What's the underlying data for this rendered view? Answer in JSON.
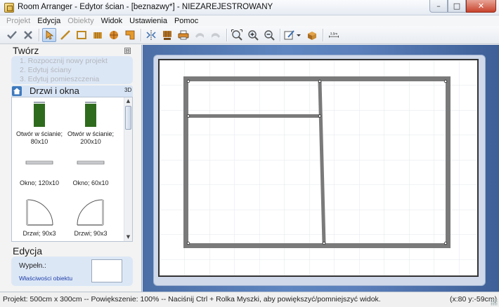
{
  "window": {
    "title": "Room Arranger - Edytor ścian - [beznazwy*] - NIEZAREJESTROWANY",
    "minimize_glyph": "–",
    "maximize_glyph": "□",
    "close_glyph": "✕"
  },
  "menu": [
    {
      "label": "Projekt",
      "enabled": false
    },
    {
      "label": "Edycja",
      "enabled": true
    },
    {
      "label": "Obiekty",
      "enabled": false
    },
    {
      "label": "Widok",
      "enabled": true
    },
    {
      "label": "Ustawienia",
      "enabled": true
    },
    {
      "label": "Pomoc",
      "enabled": true
    }
  ],
  "toolbar": {
    "icons": [
      "checkmark-icon",
      "cancel-x-icon",
      "select-arrow-icon",
      "draw-wall-icon",
      "rectangle-room-icon",
      "wall-pattern-icon",
      "round-wall-icon",
      "l-shape-icon",
      "mirror-icon",
      "layout-grid-icon",
      "print-icon",
      "undo-icon",
      "redo-icon",
      "zoom-fit-icon",
      "zoom-in-icon",
      "zoom-out-icon",
      "edit-properties-icon",
      "3d-view-icon",
      "ruler-icon"
    ],
    "ruler_label": "3,5m"
  },
  "left_panel": {
    "create_title": "Twórz",
    "collapse_glyph": "⊟",
    "steps": [
      "1. Rozpocznij nowy projekt",
      "2. Edytuj ściany",
      "3. Edytuj pomieszczenia"
    ],
    "catalog_title": "Drzwi i okna",
    "catalog_3d": "3D",
    "catalog_items": [
      {
        "label1": "Otwór w ścianie;",
        "label2": "80x10"
      },
      {
        "label1": "Otwór w ścianie;",
        "label2": "200x10"
      },
      {
        "label1": "Okno; 120x10",
        "label2": ""
      },
      {
        "label1": "Okno; 60x10",
        "label2": ""
      },
      {
        "label1": "Drzwi; 90x3",
        "label2": ""
      },
      {
        "label1": "Drzwi; 90x3",
        "label2": ""
      }
    ],
    "edit_title": "Edycja",
    "fill_label": "Wypełn.:",
    "properties_link": "Właściwości obiektu"
  },
  "status": {
    "text": "Projekt: 500cm x 300cm -- Powiększenie: 100% -- Naciśnij Ctrl + Rolka Myszki, aby powiększyć/pomniejszyć widok.",
    "coords": "(x:80 y:-59cm)"
  },
  "colors": {
    "opening_green": "#2e6b1d",
    "wall_gray": "#7a7a7a",
    "canvas_blue": "#4b6ea6"
  }
}
